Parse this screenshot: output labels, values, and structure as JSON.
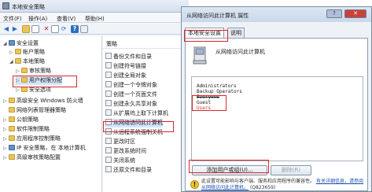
{
  "main_window": {
    "title": "本地安全策略",
    "menu": [
      "文件(F)",
      "操作(A)",
      "查看(V)",
      "帮助(H)"
    ]
  },
  "tree": [
    {
      "label": "安全设置",
      "arrow": "◢",
      "icon": "shield",
      "indent": 0,
      "selected": false,
      "interactable": true
    },
    {
      "label": "帐户策略",
      "arrow": "▷",
      "icon": "folder",
      "indent": 1,
      "selected": false,
      "interactable": true
    },
    {
      "label": "本地策略",
      "arrow": "◢",
      "icon": "folder",
      "indent": 1,
      "selected": false,
      "interactable": true
    },
    {
      "label": "审核策略",
      "arrow": "▷",
      "icon": "folder",
      "indent": 2,
      "selected": false,
      "interactable": true
    },
    {
      "label": "用户权限分配",
      "arrow": "▷",
      "icon": "folder",
      "indent": 2,
      "selected": true,
      "interactable": true
    },
    {
      "label": "安全选项",
      "arrow": "▷",
      "icon": "folder",
      "indent": 2,
      "selected": false,
      "interactable": true
    },
    {
      "label": "高级安全 Windows 防火墙",
      "arrow": "▷",
      "icon": "folder",
      "indent": 0,
      "selected": false,
      "interactable": true
    },
    {
      "label": "网络列表管理器策略",
      "arrow": "",
      "icon": "folder",
      "indent": 0,
      "selected": false,
      "interactable": true
    },
    {
      "label": "公钥策略",
      "arrow": "▷",
      "icon": "folder",
      "indent": 0,
      "selected": false,
      "interactable": true
    },
    {
      "label": "软件限制策略",
      "arrow": "▷",
      "icon": "folder",
      "indent": 0,
      "selected": false,
      "interactable": true
    },
    {
      "label": "应用程序控制策略",
      "arrow": "▷",
      "icon": "folder",
      "indent": 0,
      "selected": false,
      "interactable": true
    },
    {
      "label": "IP 安全策略，在 本地计算机",
      "arrow": "▷",
      "icon": "shield",
      "indent": 0,
      "selected": false,
      "interactable": true
    },
    {
      "label": "高级审核策略配置",
      "arrow": "▷",
      "icon": "folder",
      "indent": 0,
      "selected": false,
      "interactable": true
    }
  ],
  "list_header": "策略",
  "policies": [
    {
      "label": "备份文件和目录",
      "selected": false
    },
    {
      "label": "创建符号链接",
      "selected": false
    },
    {
      "label": "创建全局对象",
      "selected": false
    },
    {
      "label": "创建一个令牌对象",
      "selected": false
    },
    {
      "label": "创建一个页面文件",
      "selected": false
    },
    {
      "label": "创建永久共享对象",
      "selected": false
    },
    {
      "label": "从扩展坞上取下计算机",
      "selected": false
    },
    {
      "label": "从网络访问此计算机",
      "selected": true
    },
    {
      "label": "从远程系统强制关机",
      "selected": false
    },
    {
      "label": "更改时区",
      "selected": false
    },
    {
      "label": "更改系统时间",
      "selected": false
    },
    {
      "label": "关闭系统",
      "selected": false
    },
    {
      "label": "还原文件和目录",
      "selected": false
    }
  ],
  "dialog": {
    "title": "从网络访问此计算机 属性",
    "tabs": [
      "本地安全设置",
      "说明"
    ],
    "policy_name": "从网络访问此计算机",
    "members": [
      "Administrators",
      "Backup Operators",
      "Everyone",
      "Guest",
      "Users"
    ],
    "add_button": "添加用户或组(U)...",
    "remove_button": "删除(R)",
    "warning_text": "此设置可能影响与客户端、服务和应用程序的兼容性。",
    "warning_link": "有关详细信息，请参阅从网络访问此计算机。",
    "warning_suffix": "(Q823659)"
  },
  "colors": {
    "highlight": "#d9262c",
    "selection": "#d3e5fa",
    "close_button": "#c9423a"
  }
}
